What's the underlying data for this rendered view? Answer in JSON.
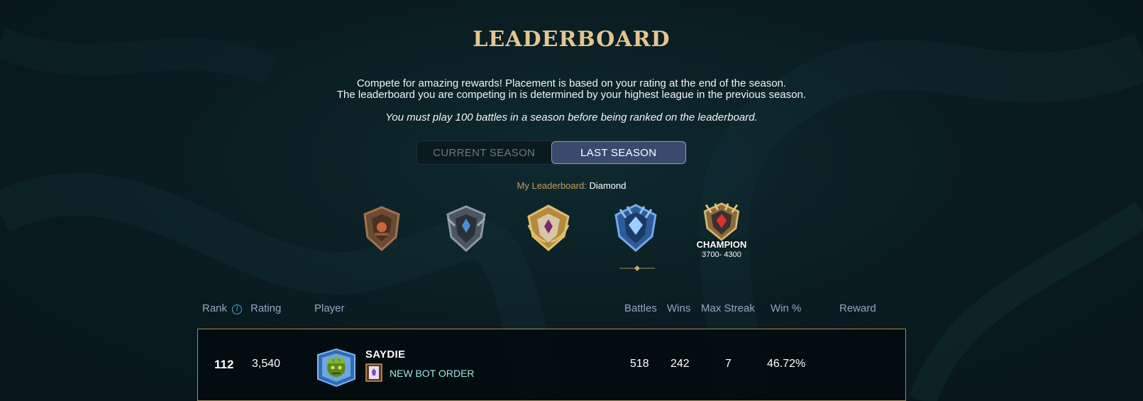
{
  "page": {
    "title": "LEADERBOARD",
    "description_line1": "Compete for amazing rewards! Placement is based on your rating at the end of the season.",
    "description_line2": "The leaderboard you are competing in is determined by your highest league in the previous season.",
    "requirement": "You must play 100 battles in a season before being ranked on the leaderboard."
  },
  "season_toggle": {
    "current_label": "CURRENT SEASON",
    "last_label": "LAST SEASON",
    "selected": "LAST SEASON"
  },
  "my_leaderboard": {
    "label": "My Leaderboard:",
    "value": "Diamond"
  },
  "leagues": [
    {
      "icon": "bronze-league-icon",
      "name": "",
      "range": ""
    },
    {
      "icon": "silver-league-icon",
      "name": "",
      "range": ""
    },
    {
      "icon": "gold-league-icon",
      "name": "",
      "range": ""
    },
    {
      "icon": "diamond-league-icon",
      "name": "",
      "range": "",
      "selected": true
    },
    {
      "icon": "champion-league-icon",
      "name": "CHAMPION",
      "range": "3700- 4300"
    }
  ],
  "table": {
    "headers": {
      "rank": "Rank",
      "rating": "Rating",
      "player": "Player",
      "battles": "Battles",
      "wins": "Wins",
      "max_streak": "Max Streak",
      "win_pct": "Win %",
      "reward": "Reward"
    },
    "rows": [
      {
        "rank": "112",
        "rating": "3,540",
        "player": "SAYDIE",
        "guild": "NEW BOT ORDER",
        "battles": "518",
        "wins": "242",
        "max_streak": "7",
        "win_pct": "46.72%",
        "reward": ""
      }
    ]
  },
  "colors": {
    "title_gold": "#e3c590",
    "label_orange": "#c99a56",
    "header_blue": "#9aa3c4",
    "active_tab": "#394a6e",
    "row_border": "#a88b52",
    "guild_cyan": "#9fe6ea"
  }
}
